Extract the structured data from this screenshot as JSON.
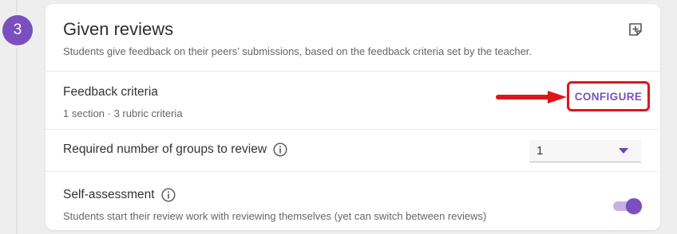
{
  "step": {
    "number": "3"
  },
  "section": {
    "title": "Given reviews",
    "subtitle": "Students give feedback on their peers’ submissions, based on the feedback criteria set by the teacher."
  },
  "feedback_criteria": {
    "label": "Feedback criteria",
    "summary": "1 section · 3 rubric criteria",
    "configure_label": "CONFIGURE"
  },
  "groups_to_review": {
    "label": "Required number of groups to review",
    "selected_value": "1"
  },
  "self_assessment": {
    "label": "Self-assessment",
    "description": "Students start their review work with reviewing themselves (yet can switch between reviews)",
    "enabled": true
  },
  "colors": {
    "accent": "#7b4fc0",
    "highlight": "#e0141b",
    "background": "#efeeee",
    "card": "#ffffff"
  },
  "icons": {
    "header_action": "note-add-icon",
    "info": "info-icon",
    "dropdown": "caret-down-icon",
    "annotation": "red-arrow"
  }
}
